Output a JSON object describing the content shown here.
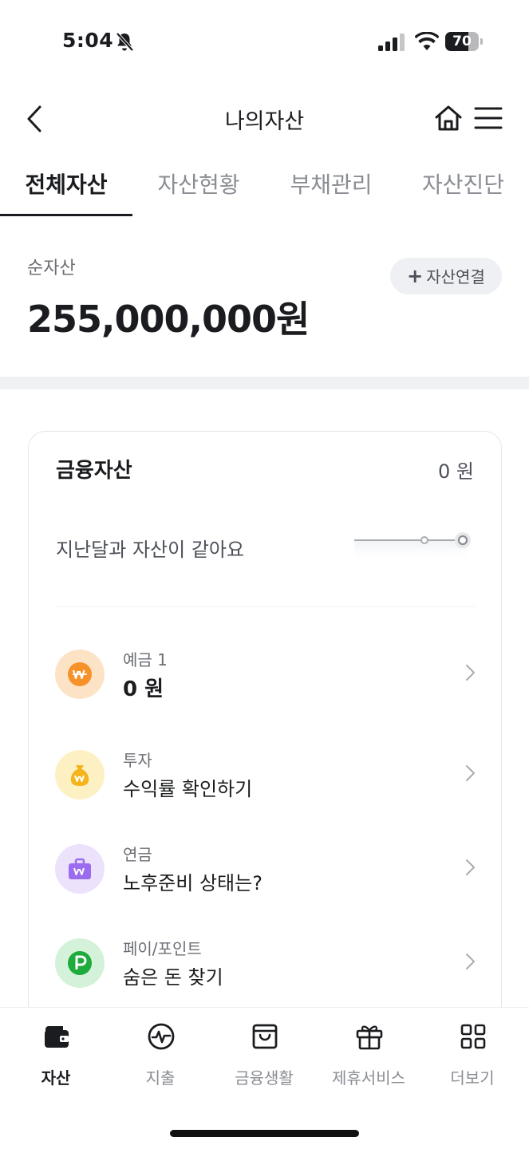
{
  "status_bar": {
    "time": "5:04",
    "battery": "70",
    "battery_level": 0.7,
    "icons": [
      "bell-slash-icon",
      "signal-icon",
      "wifi-icon",
      "battery-icon"
    ]
  },
  "header": {
    "title": "나의자산",
    "icons": [
      "back-icon",
      "home-icon",
      "menu-icon"
    ]
  },
  "tabs": [
    {
      "label": "전체자산",
      "active": true
    },
    {
      "label": "자산현황",
      "active": false
    },
    {
      "label": "부채관리",
      "active": false
    },
    {
      "label": "자산진단",
      "active": false
    }
  ],
  "summary": {
    "net_label": "순자산",
    "net_value": "255,000,000원",
    "connect_button": "자산연결"
  },
  "financial_card": {
    "title": "금융자산",
    "total": "0 원",
    "note": "지난달과 자산이 같아요",
    "items": [
      {
        "label": "예금 1",
        "value": "0 원",
        "icon": "won-coin-icon",
        "color": "#f6922a",
        "bg": "#fde3c6"
      },
      {
        "label": "투자",
        "value": "수익률 확인하기",
        "icon": "money-bag-icon",
        "color": "#f3b41c",
        "bg": "#fdf1c4"
      },
      {
        "label": "연금",
        "value": "노후준비 상태는?",
        "icon": "briefcase-icon",
        "color": "#9b6cf0",
        "bg": "#ece2fc"
      },
      {
        "label": "페이/포인트",
        "value": "숨은 돈 찾기",
        "icon": "point-p-icon",
        "color": "#1dab3c",
        "bg": "#d4f2da"
      }
    ]
  },
  "bottom_nav": [
    {
      "label": "자산",
      "icon": "wallet-icon",
      "active": true
    },
    {
      "label": "지출",
      "icon": "won-pulse-icon",
      "active": false
    },
    {
      "label": "금융생활",
      "icon": "shopping-bag-icon",
      "active": false
    },
    {
      "label": "제휴서비스",
      "icon": "gift-icon",
      "active": false
    },
    {
      "label": "더보기",
      "icon": "grid-icon",
      "active": false
    }
  ]
}
